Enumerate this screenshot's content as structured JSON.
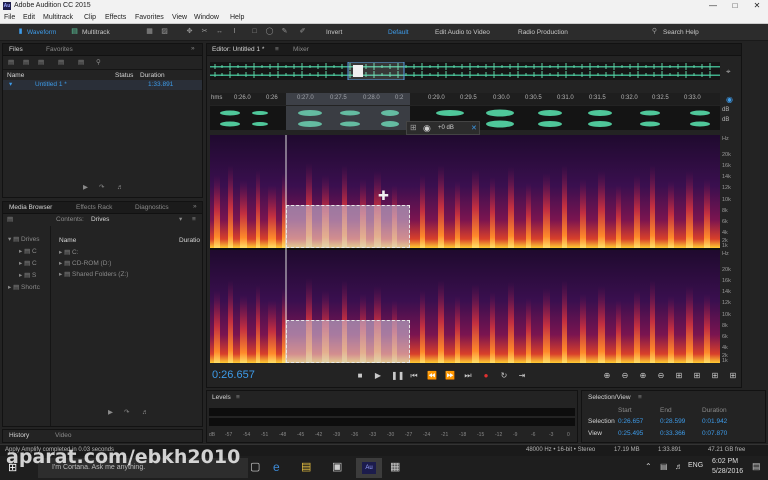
{
  "titlebar": {
    "app_icon": "Au",
    "title": "Adobe Audition CC 2015"
  },
  "menubar": {
    "items": [
      "File",
      "Edit",
      "Multitrack",
      "Clip",
      "Effects",
      "Favorites",
      "View",
      "Window",
      "Help"
    ]
  },
  "toolbar": {
    "waveform_label": "Waveform",
    "multitrack_label": "Multitrack",
    "invert_label": "Invert",
    "workspace_default": "Default",
    "workspace_video": "Edit Audio to Video",
    "workspace_radio": "Radio Production",
    "search_label": "Search Help"
  },
  "files_panel": {
    "tabs": [
      "Files",
      "Favorites"
    ],
    "columns": {
      "name": "Name",
      "status": "Status",
      "duration": "Duration"
    },
    "rows": [
      {
        "name": "Untitled 1 *",
        "duration": "1:33.891"
      }
    ]
  },
  "media_browser": {
    "tabs": [
      "Media Browser",
      "Effects Rack",
      "Diagnostics"
    ],
    "contents_label": "Contents:",
    "contents_value": "Drives",
    "left_tree": [
      "Drives",
      "C",
      "C",
      "S",
      "Shortc"
    ],
    "column_name": "Name",
    "column_duration": "Duratio",
    "items": [
      "C:",
      "CD-ROM (D:)",
      "Shared Folders (Z:)"
    ]
  },
  "history": {
    "tabs": [
      "History",
      "Video"
    ]
  },
  "editor": {
    "tabs": [
      "Editor: Untitled 1 *",
      "Mixer"
    ],
    "ruler_unit": "hms",
    "ruler_ticks": [
      "0:26.0",
      "0:26",
      "0:27.0",
      "0:27.5",
      "0:28.0",
      "0:2",
      "0:29.0",
      "0:29.5",
      "0:30.0",
      "0:30.5",
      "0:31.0",
      "0:31.5",
      "0:32.0",
      "0:32.5",
      "0:33.0"
    ],
    "hud_gain": "+0 dB",
    "db_label": "dB",
    "hz_top": [
      "Hz",
      "20k",
      "16k",
      "14k",
      "12k",
      "10k",
      "8k",
      "6k",
      "4k",
      "2k",
      "1k"
    ],
    "hz_bottom": [
      "Hz",
      "20k",
      "16k",
      "14k",
      "12k",
      "10k",
      "8k",
      "6k",
      "4k",
      "2k",
      "1k"
    ],
    "current_time": "0:26.657"
  },
  "levels": {
    "title": "Levels",
    "scale": [
      "dB",
      "-57",
      "-54",
      "-51",
      "-48",
      "-45",
      "-42",
      "-39",
      "-36",
      "-33",
      "-30",
      "-27",
      "-24",
      "-21",
      "-18",
      "-15",
      "-12",
      "-9",
      "-6",
      "-3",
      "0"
    ]
  },
  "selection_view": {
    "title": "Selection/View",
    "headers": [
      "Start",
      "End",
      "Duration"
    ],
    "selection_label": "Selection",
    "selection": [
      "0:26.657",
      "0:28.599",
      "0:01.942"
    ],
    "view_label": "View",
    "view": [
      "0:25.495",
      "0:33.366",
      "0:07.870"
    ]
  },
  "status_bar": {
    "message": "Apply Amplify completed in 0.03 seconds",
    "format": "48000 Hz • 16-bit • Stereo",
    "size": "17.19 MB",
    "duration": "1:33.891",
    "free": "47.21 GB free"
  },
  "taskbar": {
    "cortana_text": "I'm Cortana. Ask me anything.",
    "time": "6:02 PM",
    "date": "5/28/2016",
    "language": "ENG"
  },
  "watermark": "aparat.com/ebkh2010"
}
